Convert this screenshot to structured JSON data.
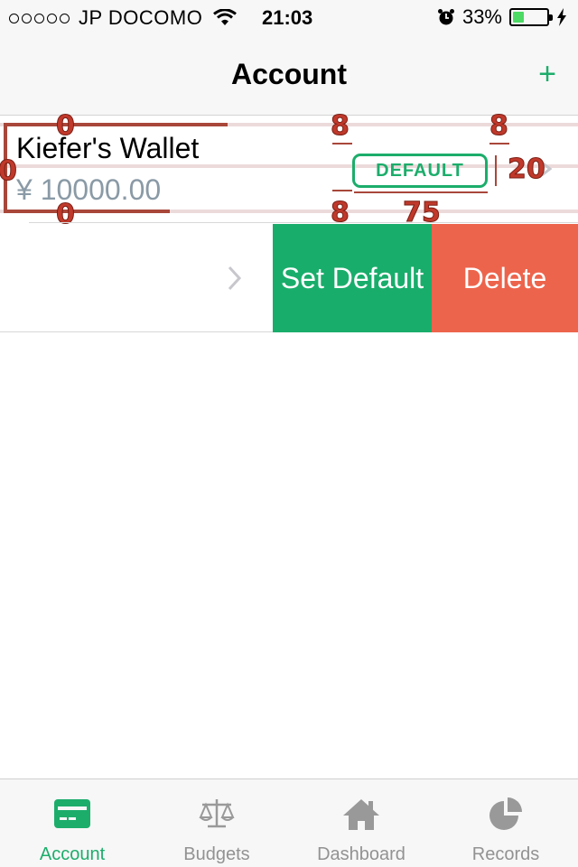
{
  "status_bar": {
    "carrier": "JP DOCOMO",
    "time": "21:03",
    "battery": "33%",
    "battery_level": 0.33
  },
  "nav": {
    "title": "Account",
    "add_label": "+"
  },
  "account": {
    "name": "Kiefer's Wallet",
    "balance": "¥ 10000.00",
    "badge": "DEFAULT"
  },
  "annotations": {
    "top_left": "0",
    "left": "0",
    "bottom_left": "0",
    "top_mid": "8",
    "top_right": "8",
    "bottom_mid": "8",
    "badge_width": "75",
    "badge_height": "20"
  },
  "swipe_actions": {
    "set_default": "Set Default",
    "delete": "Delete"
  },
  "tabs": [
    {
      "label": "Account",
      "icon": "card-icon",
      "active": true
    },
    {
      "label": "Budgets",
      "icon": "scale-icon",
      "active": false
    },
    {
      "label": "Dashboard",
      "icon": "home-icon",
      "active": false
    },
    {
      "label": "Records",
      "icon": "pie-chart-icon",
      "active": false
    }
  ],
  "colors": {
    "accent": "#1cad6b",
    "delete": "#ed644c",
    "annotation": "#c0392b"
  }
}
